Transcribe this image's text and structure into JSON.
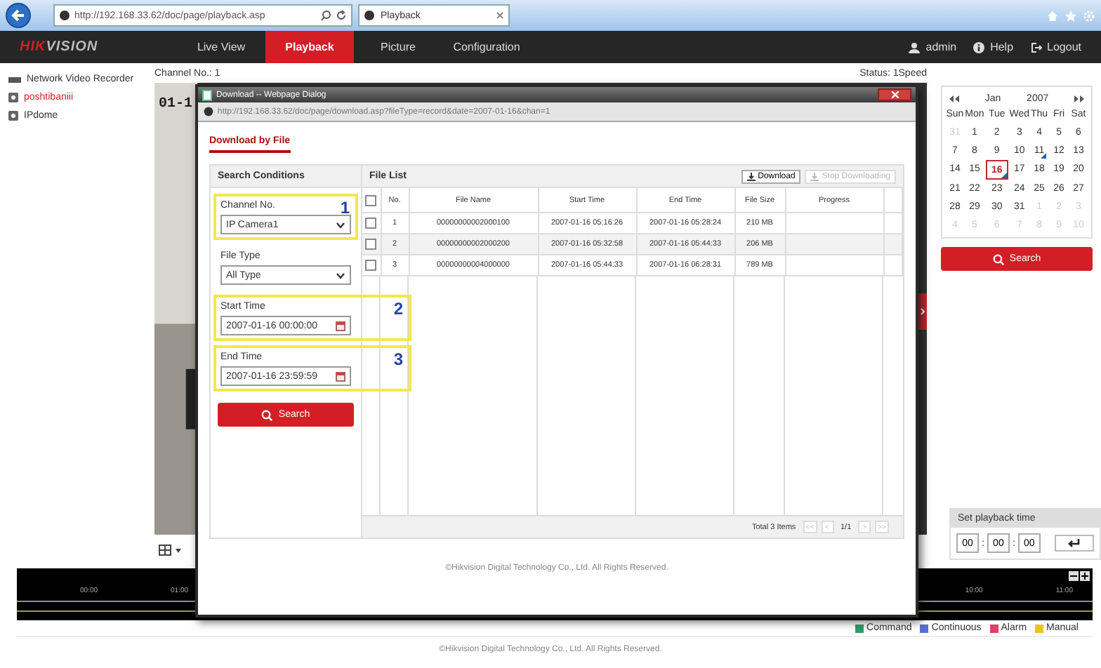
{
  "browser": {
    "address": "http://192.168.33.62/doc/page/playback.asp",
    "tab": "Playback"
  },
  "nav": {
    "logo_accent": "HIK",
    "logo": "VISION",
    "tabs": [
      {
        "label": "Live View",
        "selected": false
      },
      {
        "label": "Playback",
        "selected": true
      },
      {
        "label": "Picture",
        "selected": false
      },
      {
        "label": "Configuration",
        "selected": false
      }
    ],
    "user": "admin",
    "help": "Help",
    "logout": "Logout"
  },
  "sidebar": {
    "title": "Network Video Recorder",
    "items": [
      {
        "label": "poshtibaniii",
        "selected": true
      },
      {
        "label": "IPdome",
        "selected": false
      }
    ]
  },
  "channel_label": "Channel No.: 1",
  "video_osd": "01-1",
  "status": "Status: 1Speed",
  "calendar": {
    "month": "Jan",
    "year": "2007",
    "weekdays": [
      "Sun",
      "Mon",
      "Tue",
      "Wed",
      "Thu",
      "Fri",
      "Sat"
    ],
    "days": [
      {
        "label": "31",
        "muted": true,
        "selected": false,
        "recorded": false
      },
      {
        "label": "1",
        "muted": false,
        "selected": false,
        "recorded": false
      },
      {
        "label": "2",
        "muted": false,
        "selected": false,
        "recorded": false
      },
      {
        "label": "3",
        "muted": false,
        "selected": false,
        "recorded": false
      },
      {
        "label": "4",
        "muted": false,
        "selected": false,
        "recorded": false
      },
      {
        "label": "5",
        "muted": false,
        "selected": false,
        "recorded": false
      },
      {
        "label": "6",
        "muted": false,
        "selected": false,
        "recorded": false
      },
      {
        "label": "7",
        "muted": false,
        "selected": false,
        "recorded": false
      },
      {
        "label": "8",
        "muted": false,
        "selected": false,
        "recorded": false
      },
      {
        "label": "9",
        "muted": false,
        "selected": false,
        "recorded": false
      },
      {
        "label": "10",
        "muted": false,
        "selected": false,
        "recorded": false
      },
      {
        "label": "11",
        "muted": false,
        "selected": false,
        "recorded": true
      },
      {
        "label": "12",
        "muted": false,
        "selected": false,
        "recorded": false
      },
      {
        "label": "13",
        "muted": false,
        "selected": false,
        "recorded": false
      },
      {
        "label": "14",
        "muted": false,
        "selected": false,
        "recorded": false
      },
      {
        "label": "15",
        "muted": false,
        "selected": false,
        "recorded": false
      },
      {
        "label": "16",
        "muted": false,
        "selected": true,
        "recorded": true
      },
      {
        "label": "17",
        "muted": false,
        "selected": false,
        "recorded": false
      },
      {
        "label": "18",
        "muted": false,
        "selected": false,
        "recorded": false
      },
      {
        "label": "19",
        "muted": false,
        "selected": false,
        "recorded": false
      },
      {
        "label": "20",
        "muted": false,
        "selected": false,
        "recorded": false
      },
      {
        "label": "21",
        "muted": false,
        "selected": false,
        "recorded": false
      },
      {
        "label": "22",
        "muted": false,
        "selected": false,
        "recorded": false
      },
      {
        "label": "23",
        "muted": false,
        "selected": false,
        "recorded": false
      },
      {
        "label": "24",
        "muted": false,
        "selected": false,
        "recorded": false
      },
      {
        "label": "25",
        "muted": false,
        "selected": false,
        "recorded": false
      },
      {
        "label": "26",
        "muted": false,
        "selected": false,
        "recorded": false
      },
      {
        "label": "27",
        "muted": false,
        "selected": false,
        "recorded": false
      },
      {
        "label": "28",
        "muted": false,
        "selected": false,
        "recorded": false
      },
      {
        "label": "29",
        "muted": false,
        "selected": false,
        "recorded": false
      },
      {
        "label": "30",
        "muted": false,
        "selected": false,
        "recorded": false
      },
      {
        "label": "31",
        "muted": false,
        "selected": false,
        "recorded": false
      },
      {
        "label": "1",
        "muted": true,
        "selected": false,
        "recorded": false
      },
      {
        "label": "2",
        "muted": true,
        "selected": false,
        "recorded": false
      },
      {
        "label": "3",
        "muted": true,
        "selected": false,
        "recorded": false
      },
      {
        "label": "4",
        "muted": true,
        "selected": false,
        "recorded": false
      },
      {
        "label": "5",
        "muted": true,
        "selected": false,
        "recorded": false
      },
      {
        "label": "6",
        "muted": true,
        "selected": false,
        "recorded": false
      },
      {
        "label": "7",
        "muted": true,
        "selected": false,
        "recorded": false
      },
      {
        "label": "8",
        "muted": true,
        "selected": false,
        "recorded": false
      },
      {
        "label": "9",
        "muted": true,
        "selected": false,
        "recorded": false
      },
      {
        "label": "10",
        "muted": true,
        "selected": false,
        "recorded": false
      }
    ]
  },
  "search_button": "Search",
  "playback_time": {
    "title": "Set playback time",
    "fields": [
      "00",
      "00",
      "00"
    ],
    "separator": ":"
  },
  "timeline": {
    "labels_left": [
      "00:00",
      "01:00"
    ],
    "labels_right": [
      "10:00",
      "11:00"
    ]
  },
  "legend": [
    {
      "label": "Command",
      "color": "#2e9e6e"
    },
    {
      "label": "Continuous",
      "color": "#5b6fd0"
    },
    {
      "label": "Alarm",
      "color": "#d9436e"
    },
    {
      "label": "Manual",
      "color": "#e8c22a"
    }
  ],
  "footer": "©Hikvision Digital Technology Co., Ltd. All Rights Reserved.",
  "dialog": {
    "title": "Download -- Webpage Dialog",
    "address": "http://192.168.33.62/doc/page/download.asp?fileType=record&date=2007-01-16&chan=1",
    "tab": "Download by File",
    "conditions": {
      "title": "Search Conditions",
      "fields": [
        {
          "kind": "select",
          "label": "Channel No.",
          "value": "IP Camera1",
          "marker": "1"
        },
        {
          "kind": "select",
          "label": "File Type",
          "value": "All Type"
        },
        {
          "kind": "date",
          "label": "Start Time",
          "value": "2007-01-16 00:00:00",
          "marker": "2"
        },
        {
          "kind": "date",
          "label": "End Time",
          "value": "2007-01-16 23:59:59",
          "marker": "3"
        }
      ],
      "search": "Search"
    },
    "file_list": {
      "title": "File List",
      "download": "Download",
      "stop": {
        "label": "Stop Downloading",
        "disabled": true
      },
      "all_checked": false,
      "columns": [
        "No.",
        "File Name",
        "Start Time",
        "End Time",
        "File Size",
        "Progress"
      ],
      "rows": [
        {
          "checked": false,
          "cells": [
            "1",
            "00000000002000100",
            "2007-01-16 05:16:26",
            "2007-01-16 05:28:24",
            "210 MB",
            ""
          ]
        },
        {
          "checked": false,
          "cells": [
            "2",
            "00000000002000200",
            "2007-01-16 05:32:58",
            "2007-01-16 05:44:33",
            "206 MB",
            ""
          ]
        },
        {
          "checked": false,
          "cells": [
            "3",
            "00000000004000000",
            "2007-01-16 05:44:33",
            "2007-01-16 06:28:31",
            "789 MB",
            ""
          ]
        }
      ],
      "total": "Total 3 Items",
      "pager": [
        "<<",
        "<",
        "1/1",
        ">",
        ">>"
      ]
    },
    "footer": "©Hikvision Digital Technology Co., Ltd. All Rights Reserved."
  }
}
